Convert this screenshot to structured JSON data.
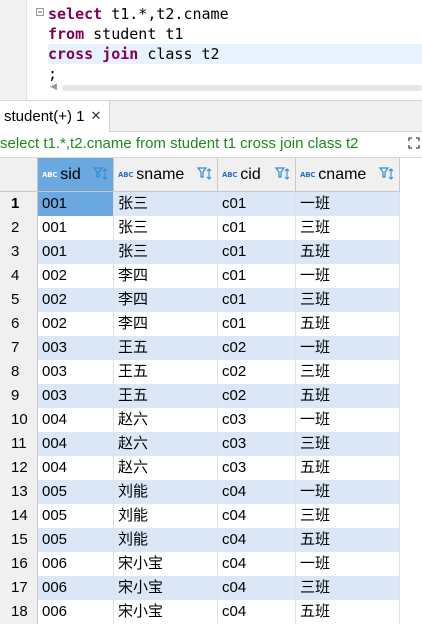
{
  "editor": {
    "lines": [
      [
        {
          "t": "select",
          "kw": true
        },
        {
          "t": " t1.*,t2.cname",
          "kw": false
        }
      ],
      [
        {
          "t": "from",
          "kw": true
        },
        {
          "t": " student t1",
          "kw": false
        }
      ],
      [
        {
          "t": "cross join",
          "kw": true
        },
        {
          "t": " class t2",
          "kw": false
        }
      ],
      [
        {
          "t": ";",
          "kw": false
        }
      ]
    ]
  },
  "tab": {
    "label": "student(+) 1",
    "close": "✕"
  },
  "filter": {
    "text": "select t1.*,t2.cname from student t1 cross join class t2"
  },
  "table": {
    "columns": [
      {
        "type_badge": "ABC",
        "label": "sid"
      },
      {
        "type_badge": "ABC",
        "label": "sname"
      },
      {
        "type_badge": "ABC",
        "label": "cid"
      },
      {
        "type_badge": "ABC",
        "label": "cname"
      }
    ],
    "rows": [
      {
        "num": "1",
        "cells": [
          "001",
          "张三",
          "c01",
          "一班"
        ]
      },
      {
        "num": "2",
        "cells": [
          "001",
          "张三",
          "c01",
          "三班"
        ]
      },
      {
        "num": "3",
        "cells": [
          "001",
          "张三",
          "c01",
          "五班"
        ]
      },
      {
        "num": "4",
        "cells": [
          "002",
          "李四",
          "c01",
          "一班"
        ]
      },
      {
        "num": "5",
        "cells": [
          "002",
          "李四",
          "c01",
          "三班"
        ]
      },
      {
        "num": "6",
        "cells": [
          "002",
          "李四",
          "c01",
          "五班"
        ]
      },
      {
        "num": "7",
        "cells": [
          "003",
          "王五",
          "c02",
          "一班"
        ]
      },
      {
        "num": "8",
        "cells": [
          "003",
          "王五",
          "c02",
          "三班"
        ]
      },
      {
        "num": "9",
        "cells": [
          "003",
          "王五",
          "c02",
          "五班"
        ]
      },
      {
        "num": "10",
        "cells": [
          "004",
          "赵六",
          "c03",
          "一班"
        ]
      },
      {
        "num": "11",
        "cells": [
          "004",
          "赵六",
          "c03",
          "三班"
        ]
      },
      {
        "num": "12",
        "cells": [
          "004",
          "赵六",
          "c03",
          "五班"
        ]
      },
      {
        "num": "13",
        "cells": [
          "005",
          "刘能",
          "c04",
          "一班"
        ]
      },
      {
        "num": "14",
        "cells": [
          "005",
          "刘能",
          "c04",
          "三班"
        ]
      },
      {
        "num": "15",
        "cells": [
          "005",
          "刘能",
          "c04",
          "五班"
        ]
      },
      {
        "num": "16",
        "cells": [
          "006",
          "宋小宝",
          "c04",
          "一班"
        ]
      },
      {
        "num": "17",
        "cells": [
          "006",
          "宋小宝",
          "c04",
          "三班"
        ]
      },
      {
        "num": "18",
        "cells": [
          "006",
          "宋小宝",
          "c04",
          "五班"
        ]
      }
    ]
  },
  "colors": {
    "keyword": "#7f0055",
    "filter_text": "#1e8a1e",
    "alt_row": "#dbe7f6",
    "selected": "#6aa8df"
  }
}
